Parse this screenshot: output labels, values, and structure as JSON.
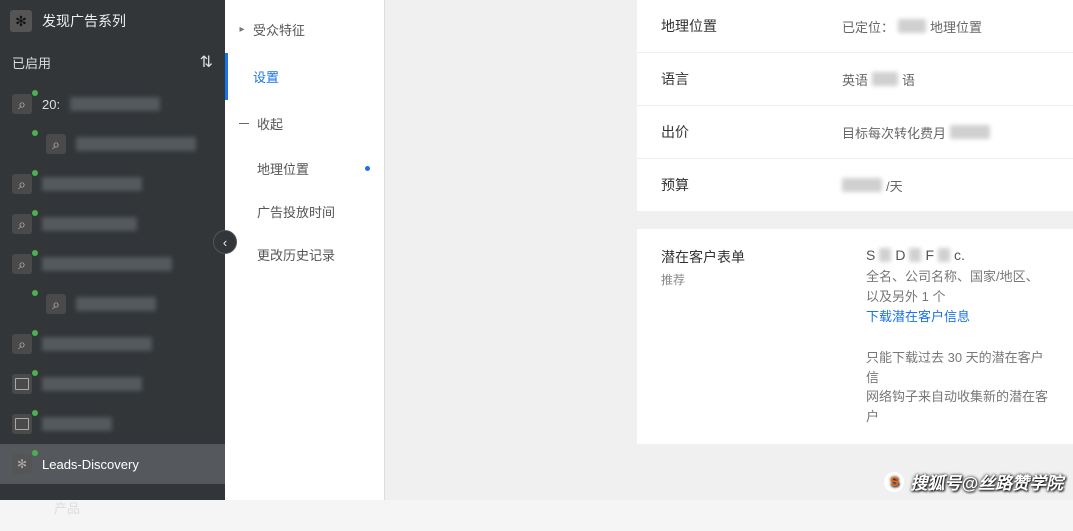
{
  "dark_sidebar": {
    "header_icon": "✻",
    "header_title": "发现广告系列",
    "status_label": "已启用",
    "swap_icon": "⇅",
    "campaigns": [
      {
        "icon": "search",
        "label": "20:",
        "label_visible": true,
        "blur_w": 90
      },
      {
        "icon": "search",
        "label": "",
        "blur_w": 120,
        "indent": true
      },
      {
        "icon": "search",
        "label": "",
        "blur_w": 100
      },
      {
        "icon": "search",
        "label": "",
        "blur_w": 95
      },
      {
        "icon": "search",
        "label": "",
        "blur_w": 130
      },
      {
        "icon": "search",
        "label": "",
        "blur_w": 80,
        "indent": true
      },
      {
        "icon": "search",
        "label": "",
        "blur_w": 110
      },
      {
        "icon": "web",
        "label": "",
        "blur_w": 100
      },
      {
        "icon": "web",
        "label": "",
        "blur_w": 70
      },
      {
        "icon": "star",
        "label": "Leads-Discovery",
        "label_visible": true,
        "selected": true
      }
    ],
    "products_label": "产品",
    "collapse_icon": "‹"
  },
  "light_sidebar": {
    "items": [
      {
        "kind": "parent",
        "label": "受众特征",
        "caret": "▸"
      },
      {
        "kind": "active",
        "label": "设置"
      },
      {
        "kind": "collapse",
        "label": "收起"
      },
      {
        "kind": "sub",
        "label": "地理位置",
        "has_dot": true
      },
      {
        "kind": "sub",
        "label": "广告投放时间"
      },
      {
        "kind": "sub",
        "label": "更改历史记录"
      }
    ]
  },
  "settings": {
    "rows": [
      {
        "label": "地理位置",
        "value_prefix": "已定位：",
        "blur_w": 28,
        "value_suffix": "地理位置"
      },
      {
        "label": "语言",
        "value_prefix": "英语",
        "blur_w": 26,
        "value_suffix": "语"
      },
      {
        "label": "出价",
        "value_prefix": "目标每次转化费月",
        "blur_w": 40,
        "value_suffix": ""
      },
      {
        "label": "预算",
        "value_prefix": "",
        "blur_w": 40,
        "value_suffix": "/天"
      }
    ]
  },
  "leads": {
    "heading": "潜在客户表单",
    "sub": "推荐",
    "form_title_suffix": "c.",
    "desc": "全名、公司名称、国家/地区、以及另外 1 个",
    "download_link": "下载潜在客户信息",
    "note": "只能下载过去 30 天的潜在客户信\n网络钩子来自动收集新的潜在客户"
  },
  "annotation_arrow": "↘",
  "watermark": {
    "icon": "S",
    "text": "搜狐号@丝路赞学院"
  }
}
